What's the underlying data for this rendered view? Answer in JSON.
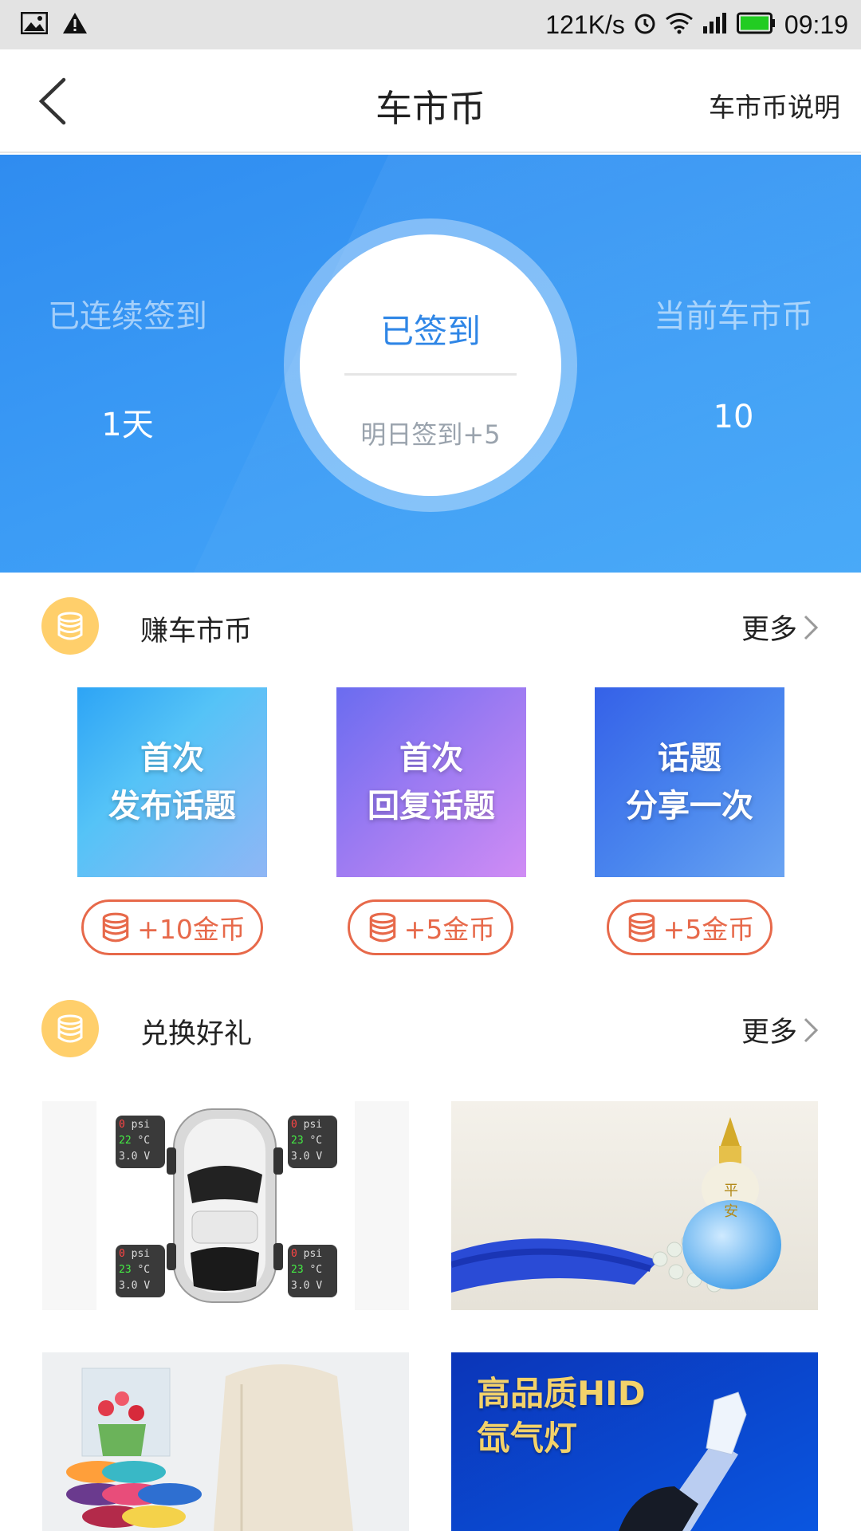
{
  "status_bar": {
    "speed": "121K/s",
    "time": "09:19"
  },
  "header": {
    "title": "车市币",
    "right_link": "车市币说明"
  },
  "checkin": {
    "streak_label": "已连续签到",
    "streak_value": "1天",
    "button_title": "已签到",
    "button_sub": "明日签到+5",
    "coins_label": "当前车市币",
    "coins_value": "10"
  },
  "earn": {
    "title": "赚车市币",
    "more": "更多",
    "tasks": [
      {
        "line1": "首次",
        "line2": "发布话题",
        "reward": "+10金币"
      },
      {
        "line1": "首次",
        "line2": "回复话题",
        "reward": "+5金币"
      },
      {
        "line1": "话题",
        "line2": "分享一次",
        "reward": "+5金币"
      }
    ]
  },
  "exchange": {
    "title": "兑换好礼",
    "more": "更多",
    "gifts": [
      {
        "icon": "tire-pressure-monitor-image",
        "readouts": [
          {
            "psi": "0",
            "temp": "22",
            "volt": "3.0"
          },
          {
            "psi": "0",
            "temp": "23",
            "volt": "3.0"
          },
          {
            "psi": "0",
            "temp": "23",
            "volt": "3.0"
          },
          {
            "psi": "0",
            "temp": "23",
            "volt": "3.0"
          }
        ],
        "units": {
          "psi": "psi",
          "temp": "°C",
          "volt": "V"
        }
      },
      {
        "icon": "car-perfume-image",
        "stamp": "平安"
      },
      {
        "icon": "towels-image"
      },
      {
        "icon": "hid-xenon-lamp-image",
        "text_line1": "高品质HID",
        "text_line2": "氙气灯"
      }
    ]
  },
  "colors": {
    "primary_blue": "#3b9bf5",
    "coin_yellow": "#ffcf6b",
    "reward_orange": "#e7694a"
  }
}
